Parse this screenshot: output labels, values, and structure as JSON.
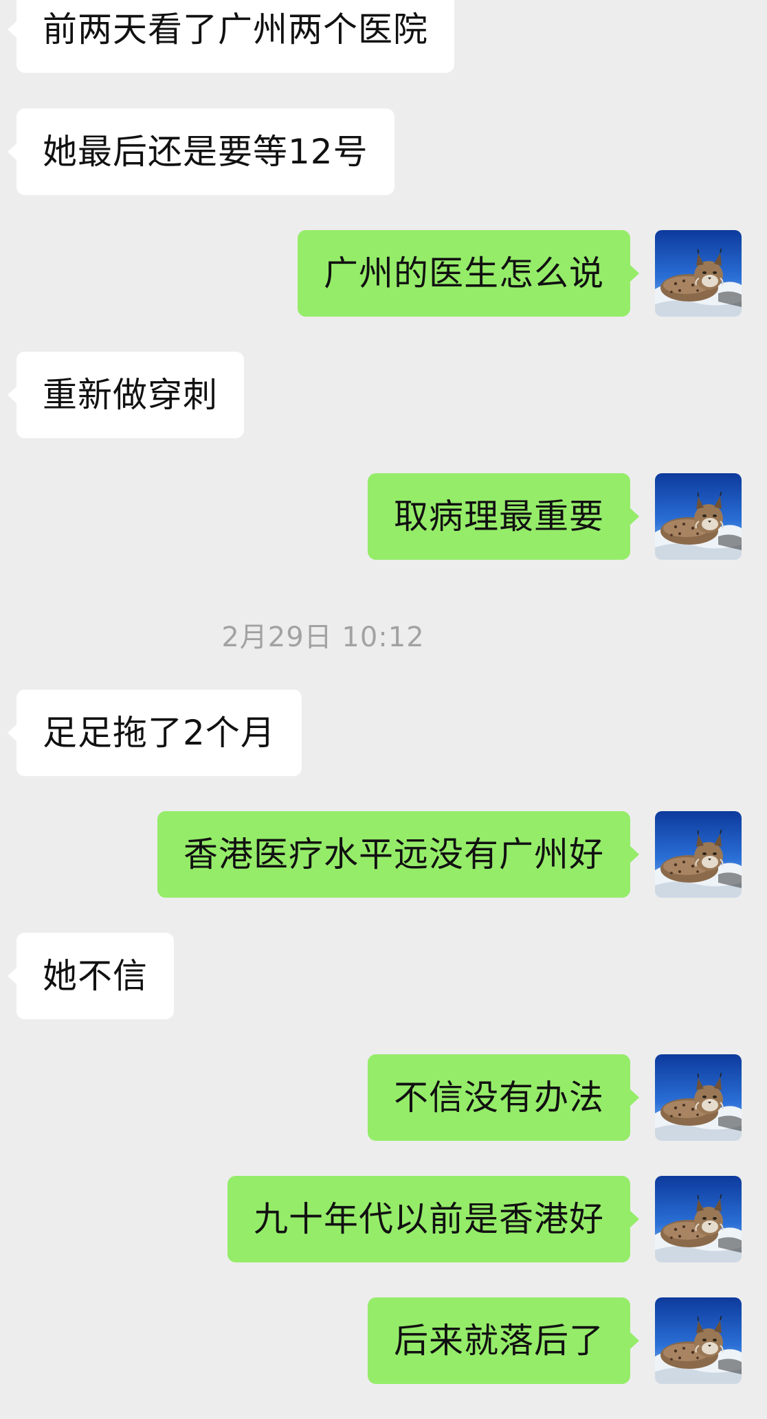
{
  "messages": [
    {
      "side": "in",
      "text": "前两天看了广州两个医院"
    },
    {
      "side": "in",
      "text": "她最后还是要等12号"
    },
    {
      "side": "out",
      "text": "广州的医生怎么说"
    },
    {
      "side": "in",
      "text": "重新做穿刺"
    },
    {
      "side": "out",
      "text": "取病理最重要"
    },
    {
      "side": "time",
      "text": "2月29日 10:12"
    },
    {
      "side": "in",
      "text": "足足拖了2个月"
    },
    {
      "side": "out",
      "text": "香港医疗水平远没有广州好"
    },
    {
      "side": "in",
      "text": "她不信"
    },
    {
      "side": "out",
      "text": "不信没有办法"
    },
    {
      "side": "out",
      "text": "九十年代以前是香港好"
    },
    {
      "side": "out",
      "text": "后来就落后了"
    }
  ],
  "colors": {
    "background": "#ededed",
    "incoming_bubble": "#ffffff",
    "outgoing_bubble": "#95ec69",
    "timestamp_text": "#a2a2a2"
  },
  "avatar_icon": "lynx-photo-avatar"
}
